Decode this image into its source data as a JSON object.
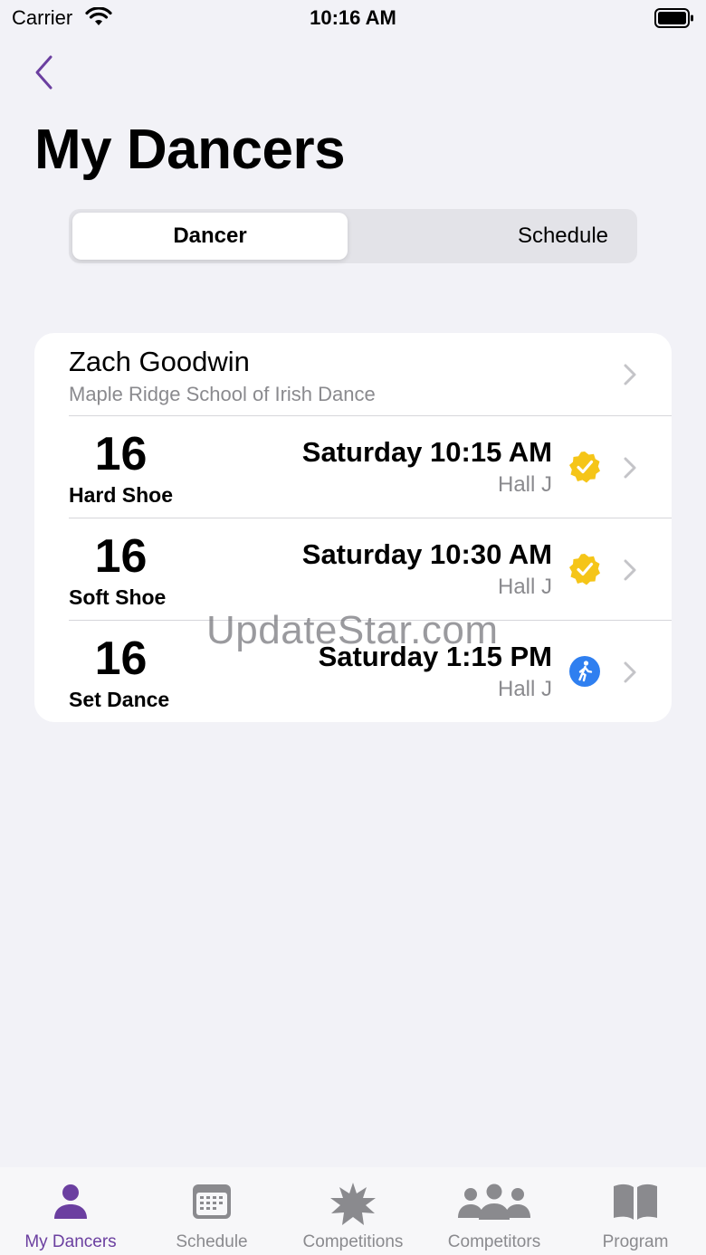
{
  "status_bar": {
    "carrier": "Carrier",
    "time": "10:16 AM"
  },
  "page": {
    "title": "My Dancers"
  },
  "segmented": {
    "options": [
      "Dancer",
      "Schedule"
    ],
    "selected": "Dancer"
  },
  "dancer": {
    "name": "Zach Goodwin",
    "school": "Maple Ridge School of Irish Dance",
    "entries": [
      {
        "number": "16",
        "dance": "Hard Shoe",
        "time": "Saturday 10:15 AM",
        "hall": "Hall J",
        "status_icon": "checkmark-seal-icon",
        "status_color": "#f5c518"
      },
      {
        "number": "16",
        "dance": "Soft Shoe",
        "time": "Saturday 10:30 AM",
        "hall": "Hall J",
        "status_icon": "checkmark-seal-icon",
        "status_color": "#f5c518"
      },
      {
        "number": "16",
        "dance": "Set Dance",
        "time": "Saturday 1:15 PM",
        "hall": "Hall J",
        "status_icon": "walking-person-icon",
        "status_color": "#2f7ff0"
      }
    ]
  },
  "watermark": "UpdateStar.com",
  "tabs": [
    {
      "label": "My Dancers",
      "icon": "person-icon",
      "active": true
    },
    {
      "label": "Schedule",
      "icon": "calendar-icon",
      "active": false
    },
    {
      "label": "Competitions",
      "icon": "starburst-icon",
      "active": false
    },
    {
      "label": "Competitors",
      "icon": "people-group-icon",
      "active": false
    },
    {
      "label": "Program",
      "icon": "book-icon",
      "active": false
    }
  ],
  "colors": {
    "accent": "#6b3fa0",
    "background": "#f2f2f7",
    "inactive": "#8a8a8e"
  }
}
